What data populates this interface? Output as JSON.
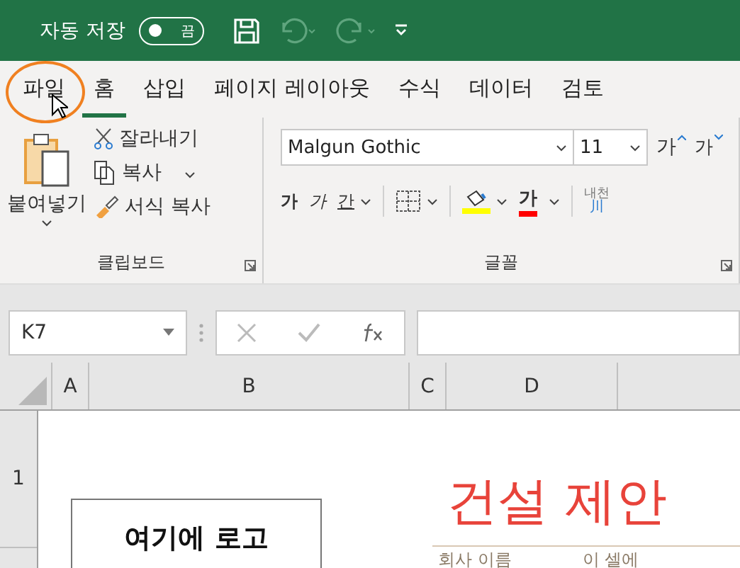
{
  "quick_access": {
    "autosave_label": "자동 저장",
    "autosave_on": false,
    "autosave_state": "끔"
  },
  "tabs": [
    {
      "label": "파일",
      "selected": false,
      "circled": true
    },
    {
      "label": "홈",
      "selected": true,
      "circled": false
    },
    {
      "label": "삽입",
      "selected": false,
      "circled": false
    },
    {
      "label": "페이지 레이아웃",
      "selected": false,
      "circled": false
    },
    {
      "label": "수식",
      "selected": false,
      "circled": false
    },
    {
      "label": "데이터",
      "selected": false,
      "circled": false
    },
    {
      "label": "검토",
      "selected": false,
      "circled": false
    }
  ],
  "clipboard": {
    "paste": "붙여넣기",
    "cut": "잘라내기",
    "copy": "복사",
    "format_painter": "서식 복사",
    "label": "클립보드"
  },
  "font": {
    "name": "Malgun Gothic",
    "size": "11",
    "grow": "가",
    "shrink": "가",
    "bold": "가",
    "italic": "가",
    "underline": "간",
    "font_color": "가",
    "phonetic_top": "내천",
    "phonetic_bottom": "川",
    "label": "글꼴"
  },
  "name_box": "K7",
  "columns": [
    "A",
    "B",
    "C",
    "D"
  ],
  "rows": [
    "1"
  ],
  "sheet": {
    "logo_box": "여기에 로고",
    "title": "건설 제안",
    "company_label": "회사 이름",
    "cell_hint": "이 셀에"
  }
}
